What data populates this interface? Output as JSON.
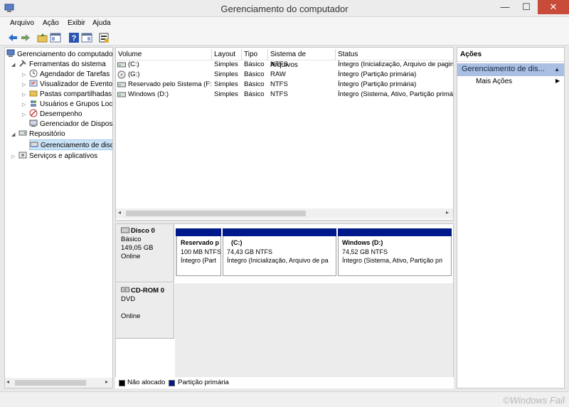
{
  "window": {
    "title": "Gerenciamento do computador",
    "minimize_glyph": "—",
    "maximize_glyph": "☐",
    "close_glyph": "✕"
  },
  "menu": [
    "Arquivo",
    "Ação",
    "Exibir",
    "Ajuda"
  ],
  "toolbar_icons": [
    "back-arrow-icon",
    "forward-arrow-icon",
    "up-folder-icon",
    "show-hide-tree-icon",
    "help-icon",
    "show-hide-action-pane-icon",
    "properties-icon"
  ],
  "tree": [
    {
      "label": "Gerenciamento do computado",
      "icon": "computer-management-icon"
    },
    {
      "label": "Ferramentas do sistema",
      "icon": "tools-icon"
    },
    {
      "label": "Agendador de Tarefas",
      "icon": "clock-icon"
    },
    {
      "label": "Visualizador de Eventos",
      "icon": "event-viewer-icon"
    },
    {
      "label": "Pastas compartilhadas",
      "icon": "shared-folder-icon"
    },
    {
      "label": "Usuários e Grupos Loca",
      "icon": "users-icon"
    },
    {
      "label": "Desempenho",
      "icon": "performance-icon"
    },
    {
      "label": "Gerenciador de Disposit",
      "icon": "device-manager-icon"
    },
    {
      "label": "Repositório",
      "icon": "storage-icon"
    },
    {
      "label": "Gerenciamento de disco",
      "icon": "disk-management-icon"
    },
    {
      "label": "Serviços e aplicativos",
      "icon": "services-icon"
    }
  ],
  "volumes": {
    "columns": [
      "Volume",
      "Layout",
      "Tipo",
      "Sistema de Arquivos",
      "Status"
    ],
    "rows": [
      [
        "(C:)",
        "Simples",
        "Básico",
        "NTFS",
        "Íntegro (Inicialização, Arquivo de pagin"
      ],
      [
        "(G:)",
        "Simples",
        "Básico",
        "RAW",
        "Íntegro (Partição primária)"
      ],
      [
        "Reservado pelo Sistema (F:)",
        "Simples",
        "Básico",
        "NTFS",
        "Íntegro (Partição primária)"
      ],
      [
        "Windows (D:)",
        "Simples",
        "Básico",
        "NTFS",
        "Íntegro (Sistema, Ativo, Partição primá"
      ]
    ]
  },
  "disks": [
    {
      "name": "Disco 0",
      "type": "Básico",
      "size": "149,05 GB",
      "state": "Online",
      "partitions": [
        {
          "name": "Reservado p",
          "size": "100 MB NTFS",
          "status": "Íntegro (Part"
        },
        {
          "name": "(C:)",
          "size": "74,43 GB NTFS",
          "status": "Íntegro (Inicialização, Arquivo de pa"
        },
        {
          "name": "Windows  (D:)",
          "size": "74,52 GB NTFS",
          "status": "Íntegro (Sistema, Ativo, Partição pri"
        }
      ]
    },
    {
      "name": "CD-ROM 0",
      "type": "DVD",
      "state": "Online"
    }
  ],
  "legend": [
    {
      "label": "Não alocado",
      "color": "#000000"
    },
    {
      "label": "Partição primária",
      "color": "#00198a"
    }
  ],
  "actions": {
    "header": "Ações",
    "selected": "Gerenciamento de dis...",
    "more": "Mais Ações"
  },
  "watermark": "©Windows Fail",
  "colors": {
    "partition_bar": "#00198a",
    "selection": "#cce4f7",
    "close_button": "#c94b3a"
  }
}
